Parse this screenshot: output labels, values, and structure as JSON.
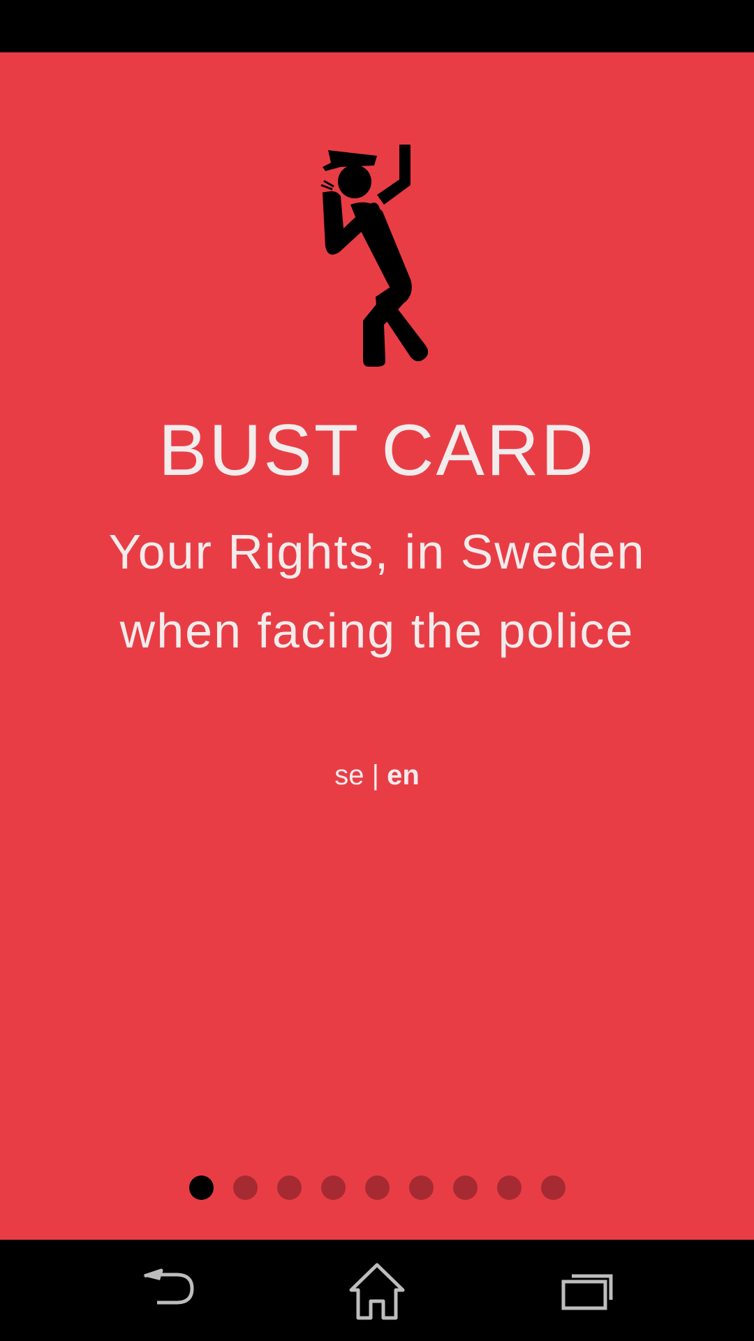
{
  "app": {
    "title": "BUST CARD",
    "subtitle_line1": "Your Rights, in Sweden",
    "subtitle_line2": "when facing the police"
  },
  "language": {
    "se": "se",
    "separator": "|",
    "en": "en",
    "selected": "en"
  },
  "pager": {
    "total": 9,
    "current": 1
  },
  "icons": {
    "hero": "police-officer-whistle-icon",
    "back": "back-icon",
    "home": "home-icon",
    "recents": "recent-apps-icon"
  },
  "colors": {
    "background": "#E93D46",
    "text": "#F3ECEC",
    "dot_inactive": "#A62A31",
    "dot_active": "#000000"
  }
}
